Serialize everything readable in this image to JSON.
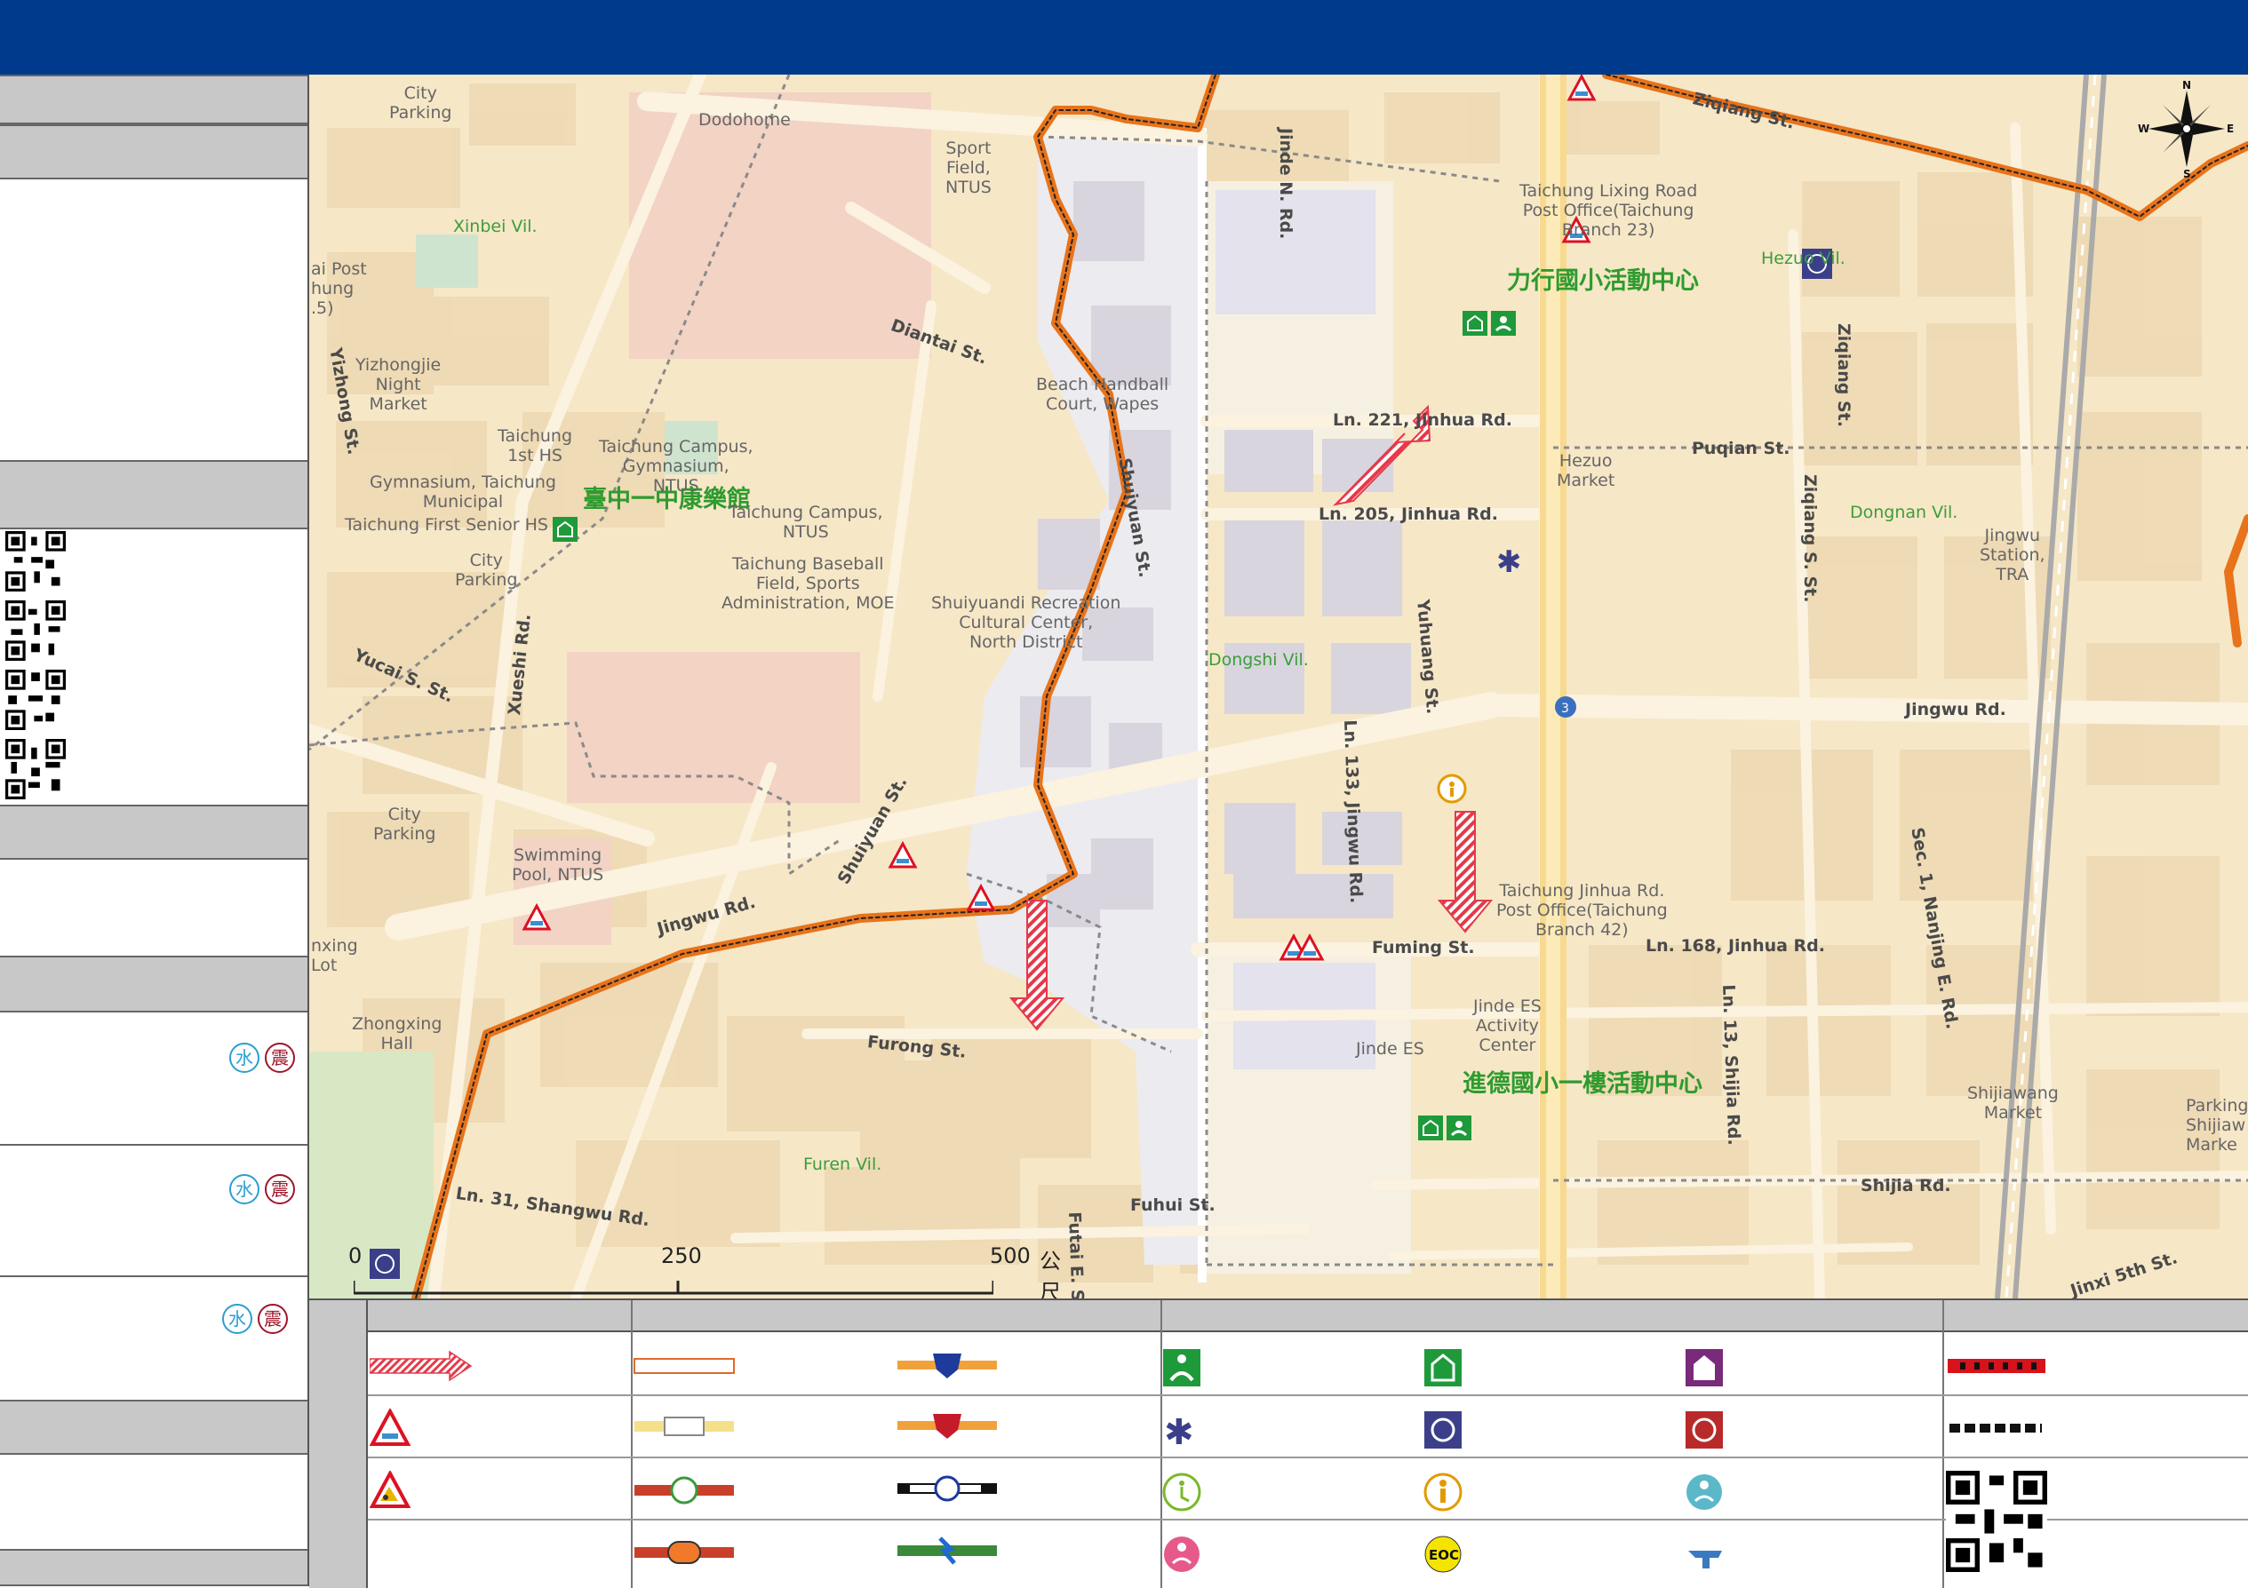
{
  "map": {
    "shelters": [
      {
        "name": "力行國小活動中心"
      },
      {
        "name": "臺中一中康樂館"
      },
      {
        "name": "進德國小一樓活動中心"
      }
    ],
    "roads": [
      "Jinde N. Rd.",
      "Ziqiang St.",
      "Diantai St.",
      "Ln. 221, Jinhua Rd.",
      "Ln. 205, Jinhua Rd.",
      "Shuiyuan St.",
      "Yuhuang St.",
      "Ln. 133, Jingwu Rd.",
      "Jingwu Rd.",
      "Jingwu Rd.",
      "Fuming St.",
      "Ln. 168, Jinhua Rd.",
      "Furong St.",
      "Ln. 31, Shangwu Rd.",
      "Yucai S. St.",
      "Shuiyuan St.",
      "Puqian St.",
      "Ziqiang St.",
      "Ziqiang S. St.",
      "Sec. 1, Nanjing E. Rd.",
      "Shijia Rd.",
      "Ln. 13, Shijia Rd.",
      "Fuhui St.",
      "Futai E. St.",
      "Yizhong St.",
      "Jinxi 5th St.",
      "Xueshi Rd."
    ],
    "pois": [
      "City\nParking",
      "Dodohome",
      "Sport\nField,\nNTUS",
      "Taichung Lixing Road\nPost Office(Taichung\nBranch 23)",
      "Hezuo\nMarket",
      "Yizhongjie\nNight\nMarket",
      "Taichung\n1st HS",
      "Taichung Campus,\nGymnasium,\nNTUS",
      "Gymnasium, Taichung\nMunicipal",
      "Taichung First Senior HS",
      "Taichung Campus,\nNTUS",
      "Taichung Baseball\nField, Sports\nAdministration, MOE",
      "Shuiyuandi Recreation\nCultural Center,\nNorth District",
      "Beach Handball\nCourt, Wapes",
      "City\nParking",
      "City\nParking",
      "Swimming\nPool, NTUS",
      "Zhongxing\nHall",
      "Taichung Jinhua Rd.\nPost Office(Taichung\nBranch 42)",
      "Jinde ES\nActivity\nCenter",
      "Jinde ES",
      "Jingwu\nStation,\nTRA",
      "Shijiawang\nMarket",
      "Parking L\nShijiaw\nMarke",
      "ai Post\nhung\n.5)",
      "nxing\nLot"
    ],
    "villages": [
      "Xinbei Vil.",
      "Dongshi Vil.",
      "Furen Vil.",
      "Dongnan Vil.",
      "Hezuo Vil."
    ],
    "scale_labels": [
      "0",
      "250",
      "500",
      "公尺"
    ],
    "compass": [
      "N",
      "S",
      "E",
      "W"
    ]
  },
  "sidebar": {
    "hazard_markers": [
      {
        "water": "水",
        "quake": "震"
      },
      {
        "water": "水",
        "quake": "震"
      },
      {
        "water": "水",
        "quake": "震"
      }
    ]
  },
  "legend": {
    "eoc_label": "EOC"
  },
  "colors": {
    "header": "#003a8c",
    "boundary": "#e8731a",
    "shelter_green": "#2e9b2e",
    "block": "#eed9b2",
    "road": "#fbf2df"
  }
}
